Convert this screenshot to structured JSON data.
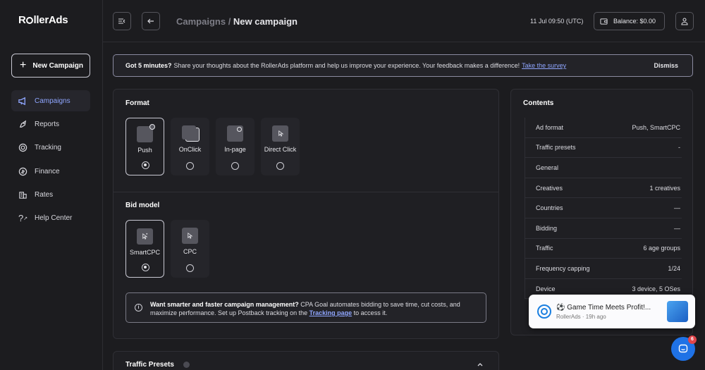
{
  "app": {
    "logo": "RollerAds"
  },
  "sidebar": {
    "new_campaign": "New Campaign",
    "items": [
      {
        "label": "Campaigns",
        "icon": "megaphone-icon",
        "active": true
      },
      {
        "label": "Reports",
        "icon": "rocket-icon"
      },
      {
        "label": "Tracking",
        "icon": "target-icon"
      },
      {
        "label": "Finance",
        "icon": "coin-icon"
      },
      {
        "label": "Rates",
        "icon": "building-icon"
      },
      {
        "label": "Help Center",
        "icon": "question-icon"
      }
    ]
  },
  "topbar": {
    "breadcrumb_parent": "Campaigns",
    "breadcrumb_sep": " / ",
    "breadcrumb_current": "New campaign",
    "datetime": "11 Jul 09:50 (UTC)",
    "balance": "Balance: $0.00"
  },
  "banner": {
    "lead": "Got 5 minutes?",
    "text": "Share your thoughts about the RollerAds platform and help us improve your experience. Your feedback makes a difference!",
    "link": "Take the survey",
    "dismiss": "Dismiss"
  },
  "format": {
    "title": "Format",
    "options": [
      "Push",
      "OnClick",
      "In-page",
      "Direct Click"
    ],
    "selected": "Push"
  },
  "bid_model": {
    "title": "Bid model",
    "options": [
      "SmartCPC",
      "CPC"
    ],
    "selected": "SmartCPC"
  },
  "info": {
    "lead": "Want smarter and faster campaign management?",
    "text": "CPA Goal automates bidding to save time, cut costs, and maximize performance. Set up Postback tracking on the",
    "link": "Tracking page",
    "tail": "to access it."
  },
  "traffic_presets": {
    "title": "Traffic Presets"
  },
  "contents": {
    "title": "Contents",
    "rows": [
      {
        "label": "Ad format",
        "value": "Push, SmartCPC"
      },
      {
        "label": "Traffic presets",
        "value": "-"
      },
      {
        "label": "General",
        "value": ""
      },
      {
        "label": "Creatives",
        "value": "1 creatives"
      },
      {
        "label": "Countries",
        "value": "—"
      },
      {
        "label": "Bidding",
        "value": "—"
      },
      {
        "label": "Traffic",
        "value": "6 age groups"
      },
      {
        "label": "Frequency capping",
        "value": "1/24"
      },
      {
        "label": "Device",
        "value": "3 device, 5 OSes"
      }
    ]
  },
  "toast": {
    "title": "⚽ Game Time Meets Profit!...",
    "source": "RollerAds",
    "time": "19h ago"
  },
  "chat": {
    "badge": "6"
  }
}
